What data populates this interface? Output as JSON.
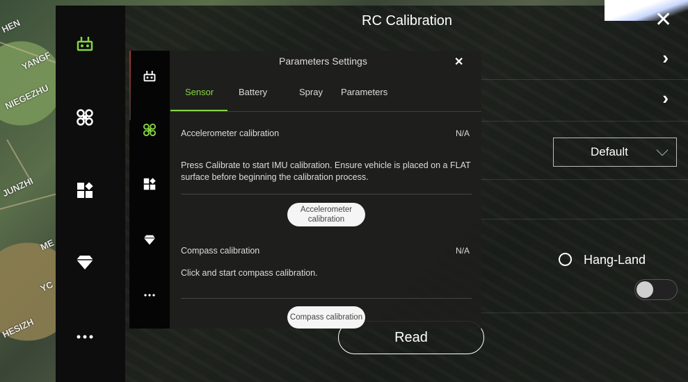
{
  "background_map": {
    "labels": [
      "HEN",
      "YANGF",
      "NIEGEZHU",
      "JUNZHI",
      "ME",
      "YC",
      "HESIZH"
    ]
  },
  "sidebar": {
    "items": [
      {
        "icon": "rc-controller-icon",
        "active": true
      },
      {
        "icon": "drone-icon",
        "active": false
      },
      {
        "icon": "apps-icon",
        "active": false
      },
      {
        "icon": "diamond-icon",
        "active": false
      },
      {
        "icon": "more-icon",
        "active": false
      }
    ]
  },
  "header": {
    "title": "RC Calibration",
    "close_glyph": "✕"
  },
  "settings_panel": {
    "row_chevron": "›",
    "dropdown_value": "Default",
    "hang_land_label": "Hang-Land",
    "read_button": "Read"
  },
  "modal": {
    "title": "Parameters Settings",
    "close_glyph": "✕",
    "tabs": [
      "Sensor",
      "Battery",
      "Spray",
      "Parameters"
    ],
    "active_tab": "Sensor",
    "accelerometer": {
      "label": "Accelerometer calibration",
      "status": "N/A",
      "description": "Press Calibrate to start IMU calibration. Ensure vehicle is placed on a FLAT surface before beginning the calibration process.",
      "button_line1": "Accelerometer",
      "button_line2": "calibration"
    },
    "compass": {
      "label": "Compass calibration",
      "status": "N/A",
      "description": "Click and start compass calibration.",
      "button": "Compass calibration"
    }
  },
  "colors": {
    "accent": "#86d442",
    "panel_bg": "#1e1e1c",
    "rail_bg": "#0d0d0d"
  }
}
